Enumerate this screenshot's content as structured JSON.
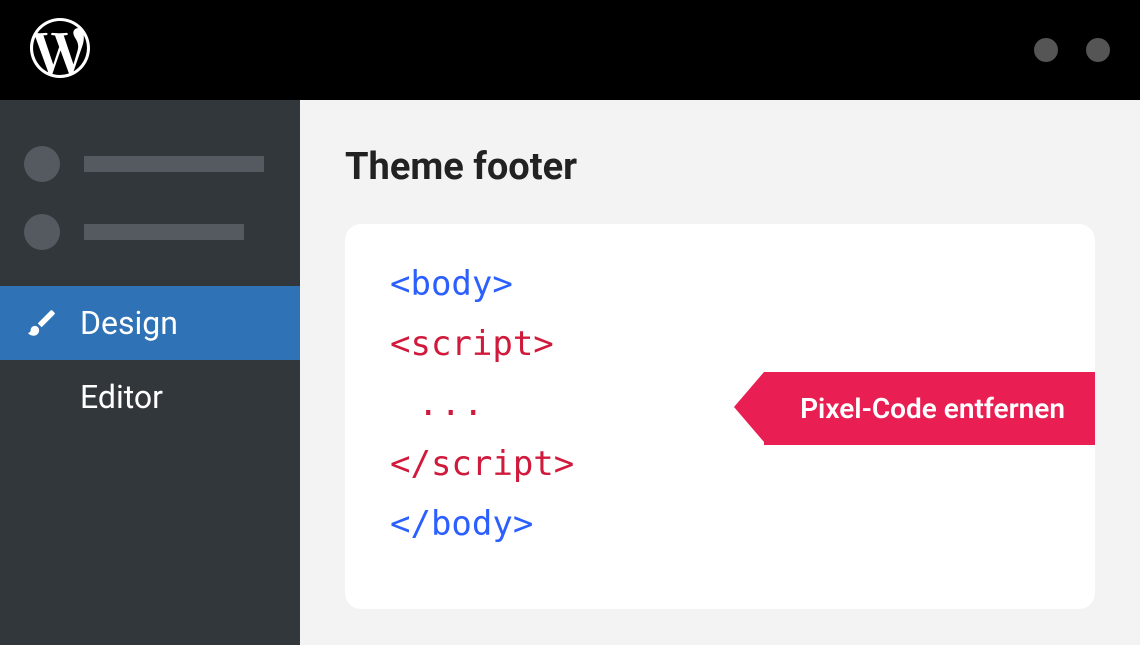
{
  "sidebar": {
    "items": [
      {
        "label": "Design"
      },
      {
        "label": "Editor"
      }
    ]
  },
  "main": {
    "title": "Theme footer",
    "code": {
      "line1": "<body>",
      "line2": "<script>",
      "line3": "...",
      "line4": "</script>",
      "line5": "</body>"
    },
    "callout": "Pixel-Code entfernen"
  }
}
